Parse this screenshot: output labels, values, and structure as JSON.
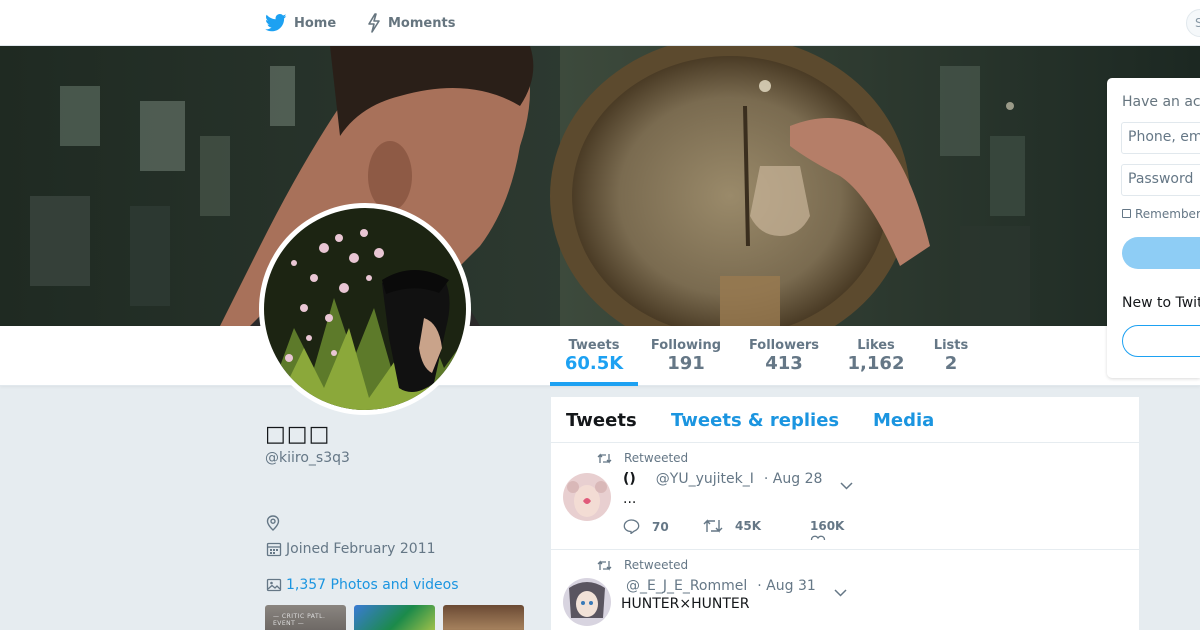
{
  "nav": {
    "home_label": "Home",
    "moments_label": "Moments",
    "search_edge": "S"
  },
  "signin": {
    "title": "Have an ac",
    "phone_placeholder": "Phone, em",
    "password_placeholder": "Password",
    "remember_label": "Remember",
    "new_to_twitter": "New to Twit"
  },
  "profile": {
    "name": "□□□",
    "handle": "@kiiro_s3q3",
    "joined": "Joined February 2011",
    "photos_link": "1,357 Photos and videos",
    "thumb1_text": "— CRITIC PATL. EVENT —",
    "stats": {
      "tweets_label": "Tweets",
      "tweets_value": "60.5K",
      "following_label": "Following",
      "following_value": "191",
      "followers_label": "Followers",
      "followers_value": "413",
      "likes_label": "Likes",
      "likes_value": "1,162",
      "lists_label": "Lists",
      "lists_value": "2"
    }
  },
  "timeline": {
    "tabs": [
      "Tweets",
      "Tweets & replies",
      "Media"
    ],
    "tweets": [
      {
        "context": "Retweeted",
        "name": "()",
        "handle": "@YU_yujitek_I",
        "date": "· Aug 28",
        "text": "...",
        "replies": "70",
        "retweets": "45K",
        "likes": "160K"
      },
      {
        "context": "Retweeted",
        "name": "",
        "handle": "@_E_J_E_Rommel",
        "date": "· Aug 31",
        "text": "HUNTER×HUNTER"
      }
    ]
  },
  "colors": {
    "accent": "#1da1f2",
    "link": "#1b95e0",
    "muted": "#657786",
    "page_bg": "#e6ecf0"
  },
  "icons": [
    "twitter-bird-icon",
    "lightning-icon",
    "location-icon",
    "calendar-icon",
    "image-icon",
    "retweet-icon",
    "reply-icon",
    "like-icon",
    "chevron-down-icon"
  ]
}
